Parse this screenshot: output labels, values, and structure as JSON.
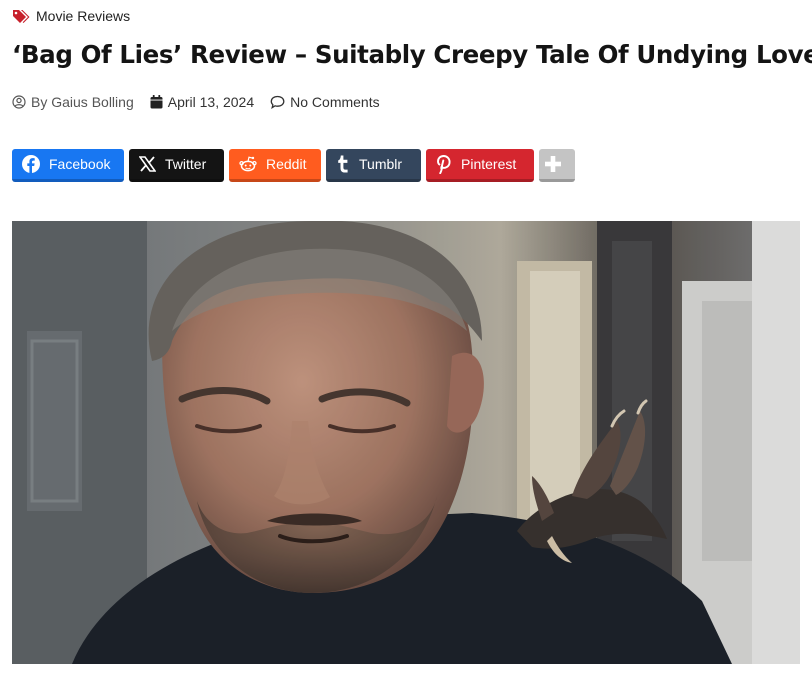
{
  "category": {
    "label": "Movie Reviews",
    "icon": "tags-icon",
    "color": "#c7202b"
  },
  "article": {
    "title": "‘Bag Of Lies’ Review – Suitably Creepy Tale Of Undying Love",
    "author_prefix": "By",
    "author": "Gaius Bolling",
    "date": "April 13, 2024",
    "comments": "No Comments"
  },
  "share_buttons": [
    {
      "label": "Facebook",
      "icon": "facebook-icon",
      "color": "#1877f2"
    },
    {
      "label": "Twitter",
      "icon": "x-twitter-icon",
      "color": "#141414"
    },
    {
      "label": "Reddit",
      "icon": "reddit-icon",
      "color": "#ff5c1f"
    },
    {
      "label": "Tumblr",
      "icon": "tumblr-icon",
      "color": "#34465d"
    },
    {
      "label": "Pinterest",
      "icon": "pinterest-icon",
      "color": "#d5262f"
    },
    {
      "label": "",
      "icon": "plus-icon",
      "color": "#c4c4c4"
    }
  ],
  "hero_image": {
    "icon": "featured-image"
  }
}
